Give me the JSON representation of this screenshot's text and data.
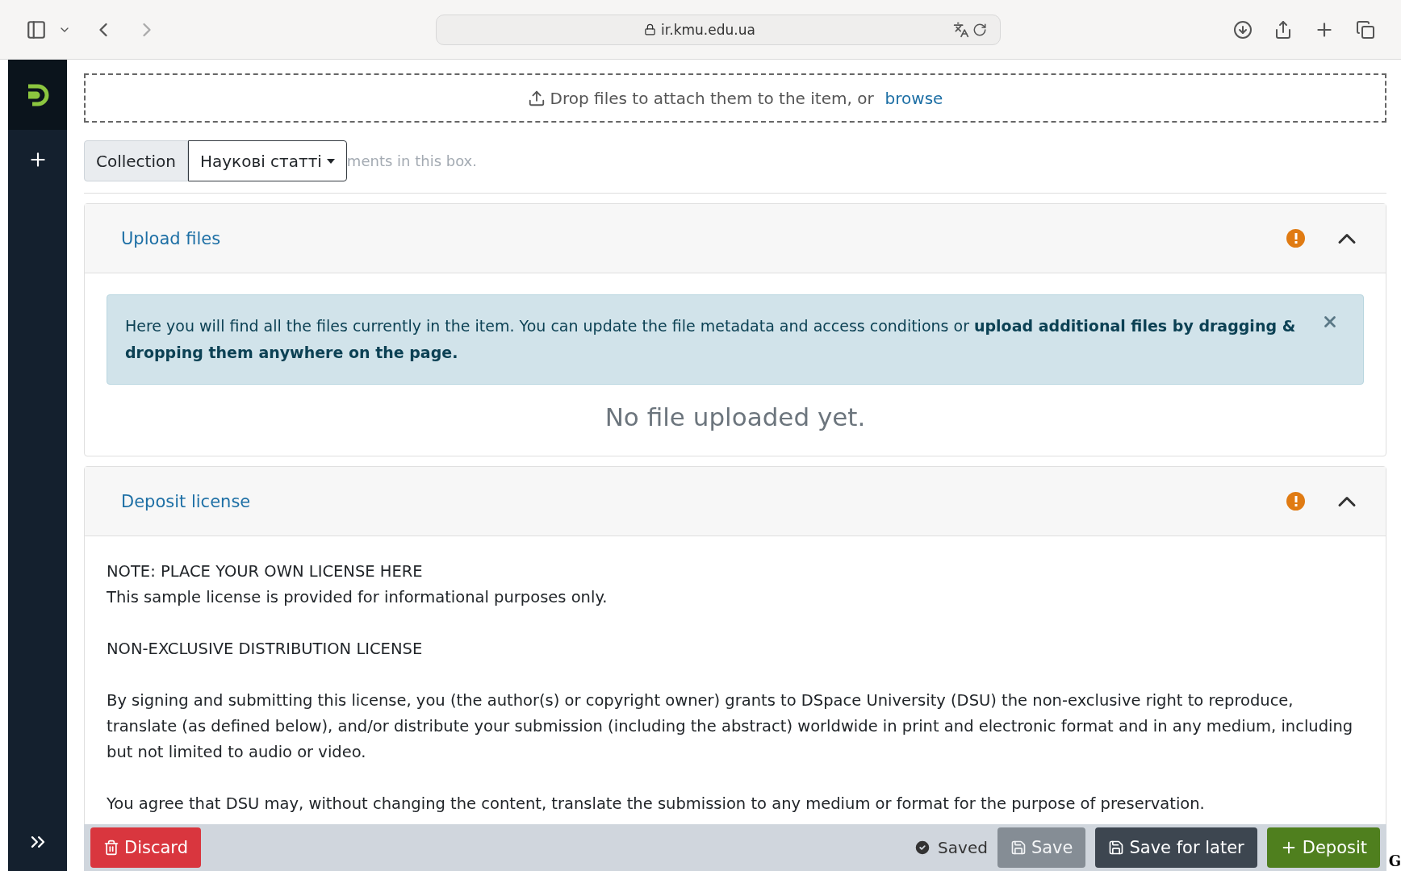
{
  "browser": {
    "url": "ir.kmu.edu.ua"
  },
  "dropzone": {
    "text": "Drop files to attach them to the item, or",
    "link": "browse"
  },
  "collection": {
    "label": "Collection",
    "value": "Наукові статті",
    "hint": "ments in this box."
  },
  "sections": [
    {
      "kind": "upload",
      "title": "Upload files",
      "warning": true,
      "expanded": true,
      "alert": "Here you will find all the files currently in the item. You can update the file metadata and access conditions or **upload additional files by dragging & dropping them anywhere on the page.**",
      "empty": "No file uploaded yet."
    },
    {
      "kind": "license",
      "title": "Deposit license",
      "warning": true,
      "expanded": true,
      "paragraphs": [
        [
          "NOTE: PLACE YOUR OWN LICENSE HERE",
          "This sample license is provided for informational purposes only."
        ],
        [
          "NON-EXCLUSIVE DISTRIBUTION LICENSE"
        ],
        [
          "By signing and submitting this license, you (the author(s) or copyright owner) grants to DSpace University (DSU) the non-exclusive right to reproduce, translate (as defined below), and/or distribute your submission (including the abstract) worldwide in print and electronic format and in any medium, including but not limited to audio or video."
        ],
        [
          "You agree that DSU may, without changing the content, translate the submission to any medium or format for the purpose of preservation."
        ]
      ]
    }
  ],
  "footer": {
    "discard": "Discard",
    "status": "Saved",
    "save": {
      "label": "Save",
      "disabled": true
    },
    "save_later": "Save for later",
    "deposit": "Deposit",
    "corner": "G"
  }
}
